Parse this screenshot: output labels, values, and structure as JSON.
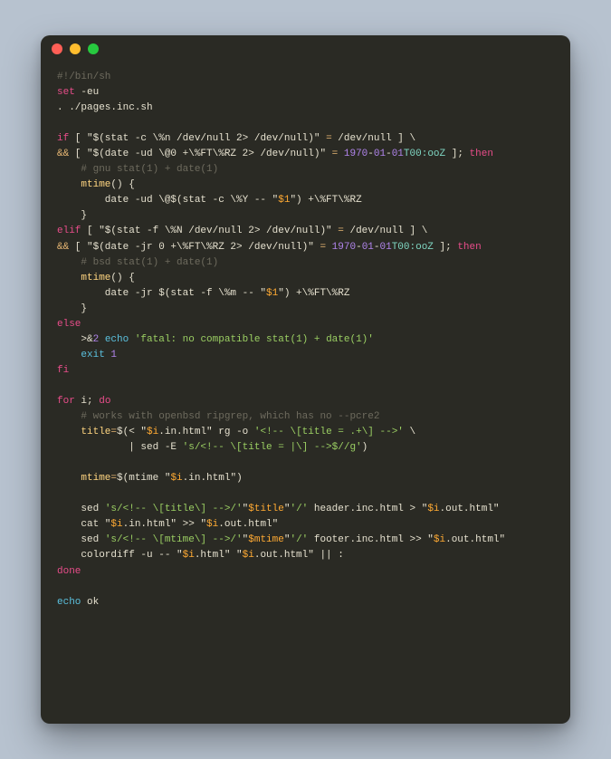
{
  "titlebar": {
    "close": "close",
    "min": "min",
    "max": "max"
  },
  "l1_shebang": "#!/bin/sh",
  "l2_set": "set",
  "l2_flags": " -eu",
  "l3_dot": ". ./pages.inc.sh",
  "l5_if": "if",
  "l5_rest_a": " [ \"$(stat -c \\%n /dev/null 2> /dev/null)\" ",
  "l5_eq": "=",
  "l5_rest_b": " /dev/null ] \\",
  "l6_and": "&&",
  "l6_body": " [ \"$(date -ud \\@0 +\\%FT\\%RZ 2> /dev/null)\" ",
  "l6_eq": "=",
  "l6_sp": " ",
  "l6_num_y": "1970",
  "l6_d1": "-",
  "l6_num_m": "01",
  "l6_d2": "-",
  "l6_num_d": "01",
  "l6_t": "T00:",
  "l6_ooz": "ooZ",
  "l6_close": " ]; ",
  "l6_then": "then",
  "l7_comment": "    # gnu stat(1) + date(1)",
  "l8_fn": "    mtime",
  "l8_rest": "() {",
  "l9_body_a": "        date -ud \\@$(stat -c \\%Y -- \"",
  "l9_var": "$1",
  "l9_body_b": "\") +\\%FT\\%RZ",
  "l10_close": "    }",
  "l11_elif": "elif",
  "l11_rest_a": " [ \"$(stat -f \\%N /dev/null 2> /dev/null)\" ",
  "l11_eq": "=",
  "l11_rest_b": " /dev/null ] \\",
  "l12_and": "&&",
  "l12_body": " [ \"$(date -jr 0 +\\%FT\\%RZ 2> /dev/null)\" ",
  "l12_eq": "=",
  "l12_sp": " ",
  "l12_close": " ]; ",
  "l12_then": "then",
  "l13_comment": "    # bsd stat(1) + date(1)",
  "l14_fn": "    mtime",
  "l14_rest": "() {",
  "l15_body_a": "        date -jr $(stat -f \\%m -- \"",
  "l15_var": "$1",
  "l15_body_b": "\") +\\%FT\\%RZ",
  "l16_close": "    }",
  "l17_else": "else",
  "l18_pre": "    >&",
  "l18_num": "2",
  "l18_sp": " ",
  "l18_echo": "echo",
  "l18_str": " 'fatal: no compatible stat(1) + date(1)'",
  "l19_pre": "    ",
  "l19_exit": "exit",
  "l19_sp": " ",
  "l19_num": "1",
  "l20_fi": "fi",
  "l22_for": "for",
  "l22_var": " i; ",
  "l22_do": "do",
  "l23_comment": "    # works with openbsd ripgrep, which has no --pcre2",
  "l24_pre": "    ",
  "l24_var": "title",
  "l24_eq": "=",
  "l24_a": "$(< \"",
  "l24_iv": "$i",
  "l24_b": ".in.html\" rg -o ",
  "l24_str": "'<!-- \\[title = .+\\] -->'",
  "l24_c": " \\",
  "l25_a": "            | sed -E ",
  "l25_str": "'s/<!-- \\[title = |\\] -->$//g'",
  "l25_c": ")",
  "l27_pre": "    ",
  "l27_var": "mtime",
  "l27_eq": "=",
  "l27_a": "$(mtime \"",
  "l27_iv": "$i",
  "l27_b": ".in.html\")",
  "l29_pre": "    sed ",
  "l29_str": "'s/<!-- \\[title\\] -->/'",
  "l29_a": "\"",
  "l29_v1": "$title",
  "l29_b": "\"",
  "l29_str2": "'/'",
  "l29_c": " header.inc.html > \"",
  "l29_iv": "$i",
  "l29_d": ".out.html\"",
  "l30_pre": "    cat \"",
  "l30_iv": "$i",
  "l30_a": ".in.html\" >> \"",
  "l30_iv2": "$i",
  "l30_b": ".out.html\"",
  "l31_pre": "    sed ",
  "l31_str": "'s/<!-- \\[mtime\\] -->/'",
  "l31_a": "\"",
  "l31_v1": "$mtime",
  "l31_b": "\"",
  "l31_str2": "'/'",
  "l31_c": " footer.inc.html >> \"",
  "l31_iv": "$i",
  "l31_d": ".out.html\"",
  "l32_pre": "    colordiff -u -- \"",
  "l32_iv": "$i",
  "l32_a": ".html\" \"",
  "l32_iv2": "$i",
  "l32_b": ".out.html\" || :",
  "l33_done": "done",
  "l35_echo": "echo",
  "l35_ok": " ok"
}
